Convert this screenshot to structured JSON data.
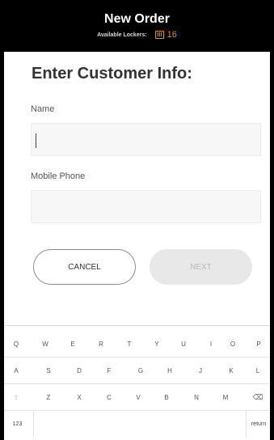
{
  "header": {
    "title": "New Order",
    "available_label": "Available Lockers:",
    "locker_icon": "locker-icon",
    "locker_count": "16",
    "accent_color": "#e38a1f"
  },
  "form": {
    "title": "Enter Customer Info:",
    "name_label": "Name",
    "name_value": "",
    "phone_label": "Mobile Phone",
    "phone_value": ""
  },
  "buttons": {
    "cancel": "CANCEL",
    "next": "NEXT"
  },
  "keyboard": {
    "row1": [
      "Q",
      "W",
      "E",
      "R",
      "T",
      "Y",
      "U",
      "I",
      "O",
      "P"
    ],
    "row2": [
      "A",
      "S",
      "D",
      "F",
      "G",
      "H",
      "J",
      "K",
      "L"
    ],
    "row3": [
      "Z",
      "X",
      "C",
      "V",
      "B",
      "N",
      "M"
    ],
    "shift": "⇧",
    "backspace": "⌫",
    "numbers": "123",
    "return": "return"
  }
}
